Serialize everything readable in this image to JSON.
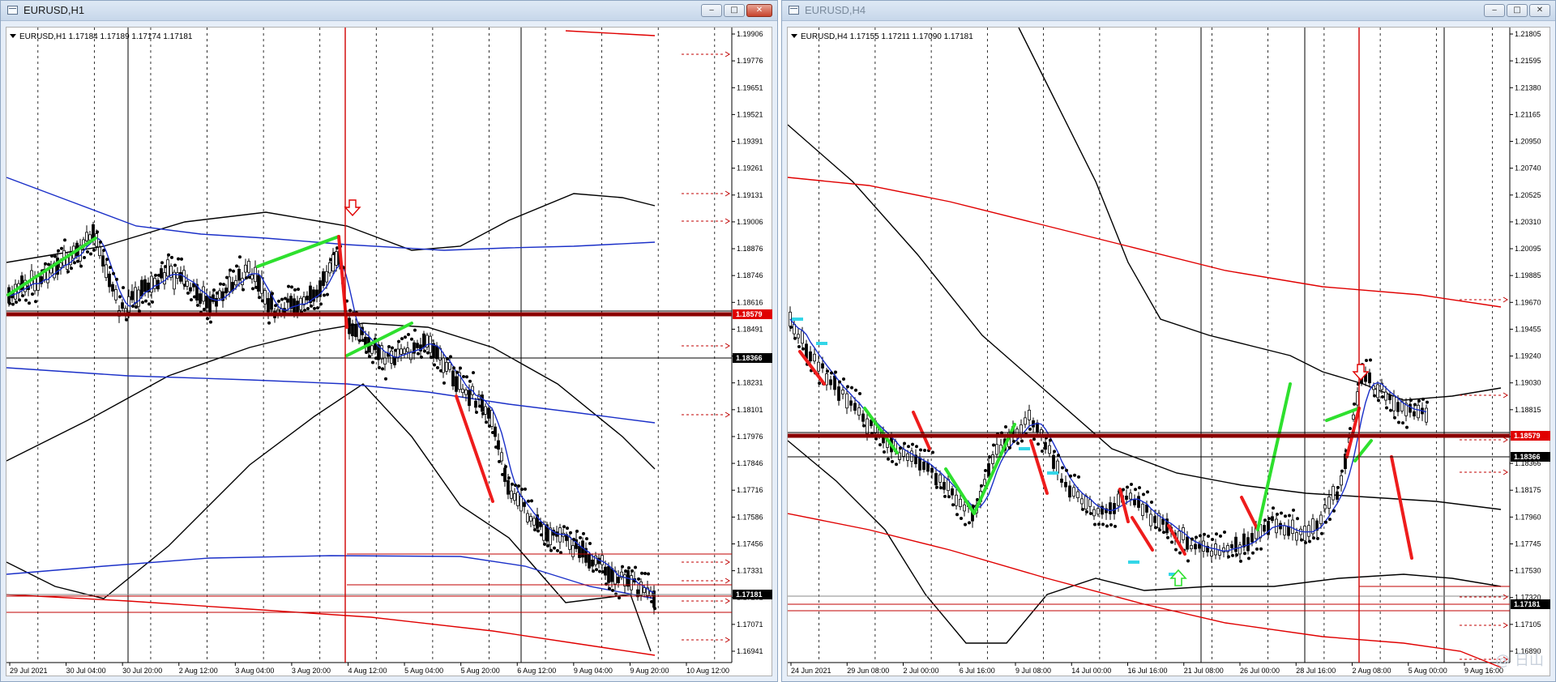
{
  "windows": [
    {
      "title": "EURUSD,H1",
      "info": "EURUSD,H1  1.17184 1.17189 1.17174 1.17181",
      "controls": {
        "minimize": "‒",
        "maximize": "□",
        "close": "✕"
      },
      "y_axis_ticks": [
        "1.19906",
        "1.19776",
        "1.19651",
        "1.19521",
        "1.19391",
        "1.19261",
        "1.19131",
        "1.19006",
        "1.18876",
        "1.18746",
        "1.18616",
        "1.18491",
        "1.18361",
        "1.18231",
        "1.18101",
        "1.17976",
        "1.17846",
        "1.17716",
        "1.17586",
        "1.17456",
        "1.17331",
        "1.17201",
        "1.17071",
        "1.16941"
      ],
      "price_tags": [
        {
          "label": "1.18579",
          "style": "red"
        },
        {
          "label": "1.18366",
          "style": "black"
        },
        {
          "label": "1.17181",
          "style": "black"
        }
      ],
      "x_axis_ticks": [
        "29 Jul 2021",
        "30 Jul 04:00",
        "30 Jul 20:00",
        "2 Aug 12:00",
        "3 Aug 04:00",
        "3 Aug 20:00",
        "4 Aug 12:00",
        "5 Aug 04:00",
        "5 Aug 20:00",
        "6 Aug 12:00",
        "9 Aug 04:00",
        "9 Aug 20:00",
        "10 Aug 12:00"
      ]
    },
    {
      "title": "EURUSD,H4",
      "info": "EURUSD,H4  1.17155 1.17211 1.17090 1.17181",
      "controls": {
        "minimize": "‒",
        "maximize": "□",
        "close": "✕"
      },
      "y_axis_ticks": [
        "1.21805",
        "1.21595",
        "1.21380",
        "1.21165",
        "1.20950",
        "1.20740",
        "1.20525",
        "1.20310",
        "1.20095",
        "1.19885",
        "1.19670",
        "1.19455",
        "1.19240",
        "1.19030",
        "1.18815",
        "1.18579",
        "1.18366",
        "1.18175",
        "1.17960",
        "1.17745",
        "1.17530",
        "1.17320",
        "1.17105",
        "1.16890"
      ],
      "price_tags": [
        {
          "label": "1.18579",
          "style": "red"
        },
        {
          "label": "1.18366",
          "style": "black"
        },
        {
          "label": "1.17181",
          "style": "black"
        }
      ],
      "x_axis_ticks": [
        "24 Jun 2021",
        "29 Jun 08:00",
        "2 Jul 00:00",
        "6 Jul 16:00",
        "9 Jul 08:00",
        "14 Jul 00:00",
        "16 Jul 16:00",
        "21 Jul 08:00",
        "26 Jul 00:00",
        "28 Jul 16:00",
        "2 Aug 08:00",
        "5 Aug 00:00",
        "9 Aug 16:00"
      ]
    }
  ],
  "colors": {
    "bull": "#2ee02e",
    "bear": "#ee1c1c",
    "ma": "#1a2fc8",
    "level": "#c00000",
    "cyan": "#33d6e8"
  },
  "watermark": "@ 日山"
}
